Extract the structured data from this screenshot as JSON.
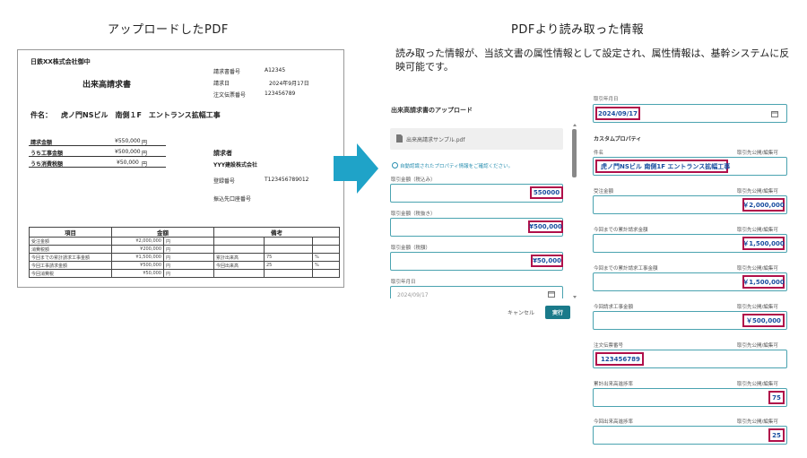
{
  "headings": {
    "left": "アップロードしたPDF",
    "right": "PDFより読み取った情報"
  },
  "description": "読み取った情報が、当該文書の属性情報として設定され、属性情報は、基幹システムに反映可能です。",
  "pdf": {
    "recipient": "日鉄XX株式会社御中",
    "title": "出来高請求書",
    "meta": [
      {
        "label": "請求書番号",
        "value": "A12345"
      },
      {
        "label": "請求日",
        "value": "2024年9月17日"
      },
      {
        "label": "注文伝票番号",
        "value": "123456789"
      }
    ],
    "subject_label": "件名：",
    "subject": "虎ノ門NSビル　南側１F　エントランス拡幅工事",
    "amounts": [
      {
        "label": "請求金額",
        "value": "¥550,000",
        "unit": "円"
      },
      {
        "label": "うち工事金額",
        "value": "¥500,000",
        "unit": "円"
      },
      {
        "label": "うち消費税額",
        "value": "¥50,000",
        "unit": "円"
      }
    ],
    "issuer_label": "請求者",
    "issuer": "YYY建設株式会社",
    "reg_label": "登録番号",
    "reg_value": "T123456789012",
    "bank_label": "振込先口座番号",
    "table_headers": [
      "項目",
      "金額",
      "備考"
    ],
    "table_rows": [
      {
        "item": "受注金額",
        "amount": "¥2,000,000",
        "unit": "円",
        "note": "",
        "val": "",
        "pct": ""
      },
      {
        "item": "消費税額",
        "amount": "¥200,000",
        "unit": "円",
        "note": "",
        "val": "",
        "pct": ""
      },
      {
        "item": "今回までの累計請求工事金額",
        "amount": "¥1,500,000",
        "unit": "円",
        "note": "累計出来高",
        "val": "75",
        "pct": "%"
      },
      {
        "item": "今回工事請求金額",
        "amount": "¥500,000",
        "unit": "円",
        "note": "今回出来高",
        "val": "25",
        "pct": "%"
      },
      {
        "item": "今回消費税",
        "amount": "¥50,000",
        "unit": "円",
        "note": "",
        "val": "",
        "pct": ""
      }
    ]
  },
  "upload": {
    "title": "出来高請求書のアップロード",
    "file_name": "出来高請求サンプル.pdf",
    "notice": "自動認識されたプロパティ情報をご確認ください。",
    "fields": [
      {
        "label": "取引金額（税込み）",
        "value": "550000"
      },
      {
        "label": "取引金額（税抜き）",
        "value": "¥500,000"
      },
      {
        "label": "取引金額（税額）",
        "value": "¥50,000"
      },
      {
        "label": "取引年月日",
        "value": "2024/09/17"
      }
    ],
    "cancel_label": "キャンセル",
    "execute_label": "実行"
  },
  "properties": {
    "date_label": "取引年月日",
    "date_value": "2024/09/17",
    "custom_title": "カスタムプロパティ",
    "access_label": "取引先公開/編集可",
    "fields": [
      {
        "label": "件名",
        "value": "虎ノ門NSビル 南側1F エントランス拡幅工事"
      },
      {
        "label": "受注金額",
        "value": "￥2,000,000"
      },
      {
        "label": "今回までの累計請求金額",
        "value": "￥1,500,000"
      },
      {
        "label": "今回までの累計請求工事金額",
        "value": "￥1,500,000"
      },
      {
        "label": "今回請求工事金額",
        "value": "￥500,000"
      },
      {
        "label": "注文伝票番号",
        "value": "123456789"
      },
      {
        "label": "累計出来高進捗率",
        "value": "75"
      },
      {
        "label": "今回出来高進捗率",
        "value": "25"
      }
    ]
  },
  "colors": {
    "accent": "#1a7a8a",
    "highlight": "#b0104a",
    "field_border": "#4aa3b0",
    "arrow": "#1fa3c8"
  }
}
